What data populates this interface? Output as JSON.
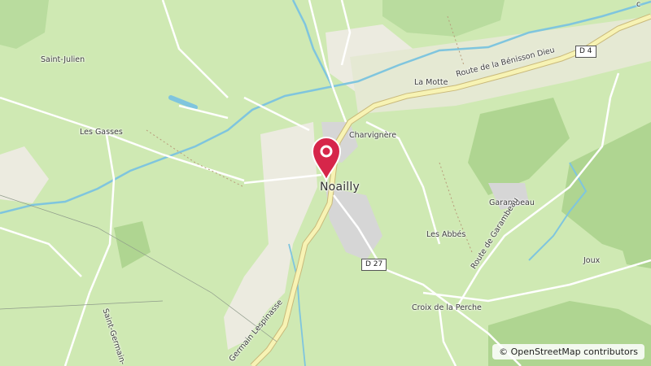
{
  "map": {
    "labels": {
      "saint_julien": "Saint-Julien",
      "les_gasses": "Les Gasses",
      "la_motte": "La Motte",
      "charvignere": "Charvignère",
      "noailly": "Noailly",
      "garambeau": "Garambeau",
      "les_abbes": "Les Abbés",
      "joux": "Joux",
      "croix_perche": "Croix de la Perche",
      "route_benisson": "Route de la Bénisson Dieu",
      "route_garambeau": "Route de Garambeau",
      "germain_lespinasse": "Germain Lespinasse",
      "saint_germain": "Saint-Germain-",
      "top_right_fragment": "c"
    },
    "road_shields": {
      "d4": "D 4",
      "d27": "D 27"
    },
    "marker": {
      "icon": "map-pin-icon",
      "color": "#d6264a"
    },
    "attribution": "© OpenStreetMap contributors",
    "colors": {
      "land": "#cfe9b3",
      "forest": "#b4d89a",
      "water": "#7fc5de",
      "road_main": "#f7f3b4",
      "road_minor": "#ffffff",
      "village": "#d8d8d8"
    }
  }
}
